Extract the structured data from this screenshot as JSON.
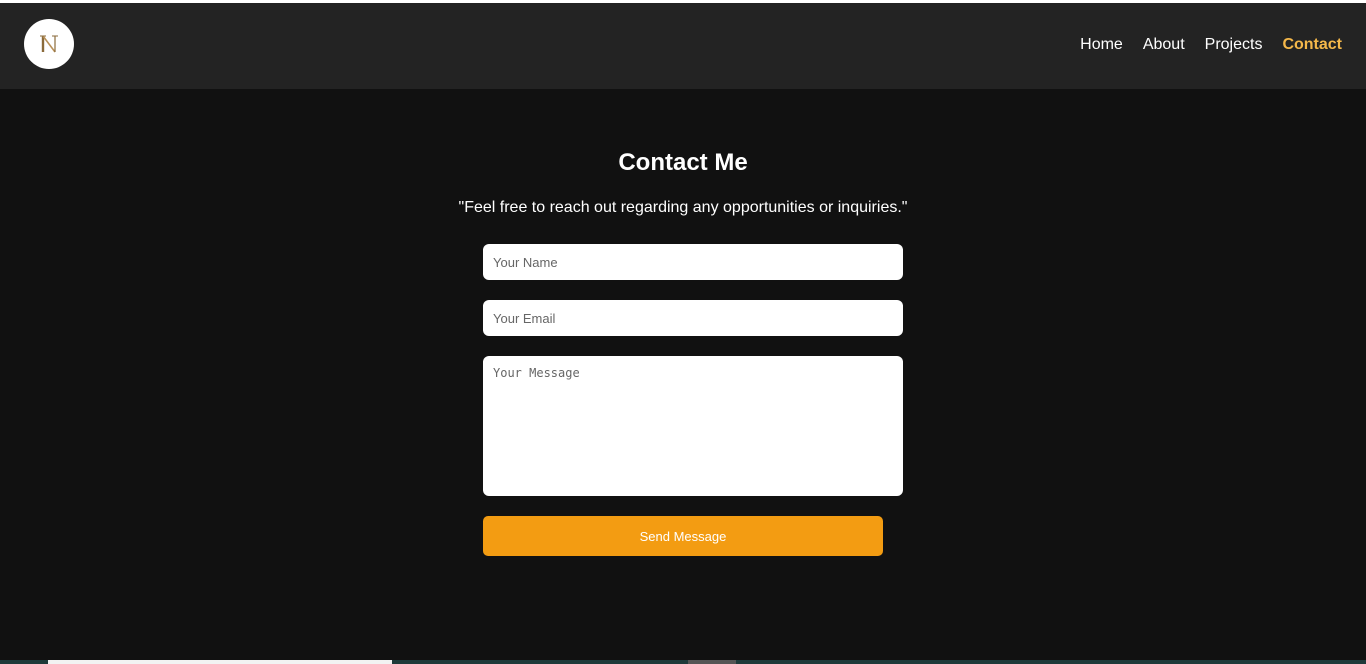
{
  "logo": {
    "letter": "N",
    "icon": "n-monogram-logo"
  },
  "nav": {
    "items": [
      {
        "label": "Home"
      },
      {
        "label": "About"
      },
      {
        "label": "Projects"
      },
      {
        "label": "Contact",
        "active": true
      }
    ]
  },
  "colors": {
    "background": "#111111",
    "navbar": "#232323",
    "accent": "#f5b84a",
    "button": "#f39c12"
  },
  "contact": {
    "title": "Contact Me",
    "subtitle": "\"Feel free to reach out regarding any opportunities or inquiries.\"",
    "name_placeholder": "Your Name",
    "name_value": "",
    "email_placeholder": "Your Email",
    "email_value": "",
    "message_placeholder": "Your Message",
    "message_value": "",
    "submit_label": "Send Message"
  }
}
